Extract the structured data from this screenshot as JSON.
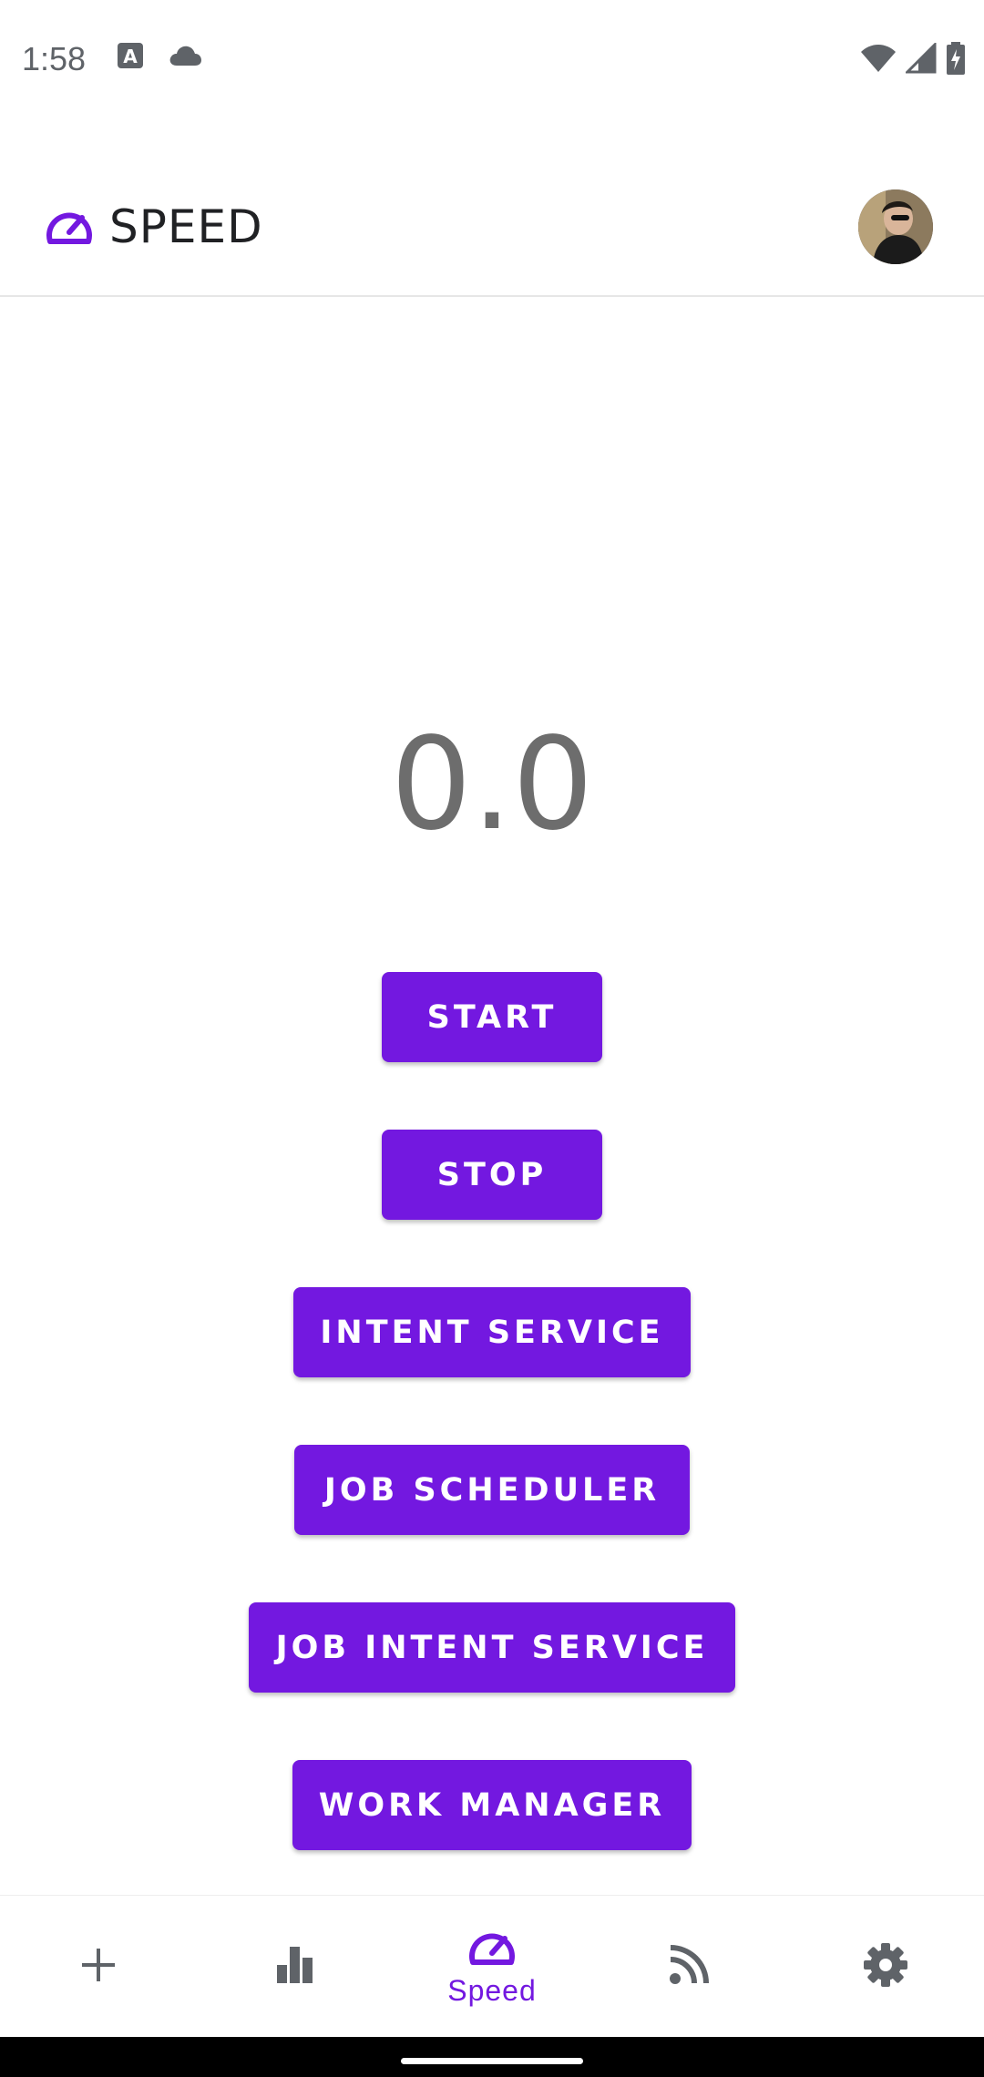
{
  "status_bar": {
    "time": "1:58",
    "icons": [
      "text-a-icon",
      "cloud-icon",
      "wifi-icon",
      "signal-icon",
      "battery-charging-icon"
    ]
  },
  "app_bar": {
    "title": "SPEED",
    "logo_icon": "speedometer-icon",
    "avatar": "user-avatar"
  },
  "main": {
    "speed_value": "0.0",
    "buttons": {
      "start": "START",
      "stop": "STOP",
      "intent_service": "INTENT SERVICE",
      "job_scheduler": "JOB SCHEDULER",
      "job_intent_service": "JOB INTENT SERVICE",
      "work_manager": "WORK MANAGER"
    }
  },
  "bottom_nav": {
    "items": [
      {
        "icon": "plus-icon",
        "label": ""
      },
      {
        "icon": "bar-chart-icon",
        "label": ""
      },
      {
        "icon": "speedometer-icon",
        "label": "Speed",
        "selected": true
      },
      {
        "icon": "rss-feed-icon",
        "label": ""
      },
      {
        "icon": "gear-icon",
        "label": ""
      }
    ]
  },
  "colors": {
    "accent": "#7318e0",
    "text_dark": "#202124",
    "speed_text": "#6d6d6d",
    "icon_gray": "#5f6368"
  }
}
